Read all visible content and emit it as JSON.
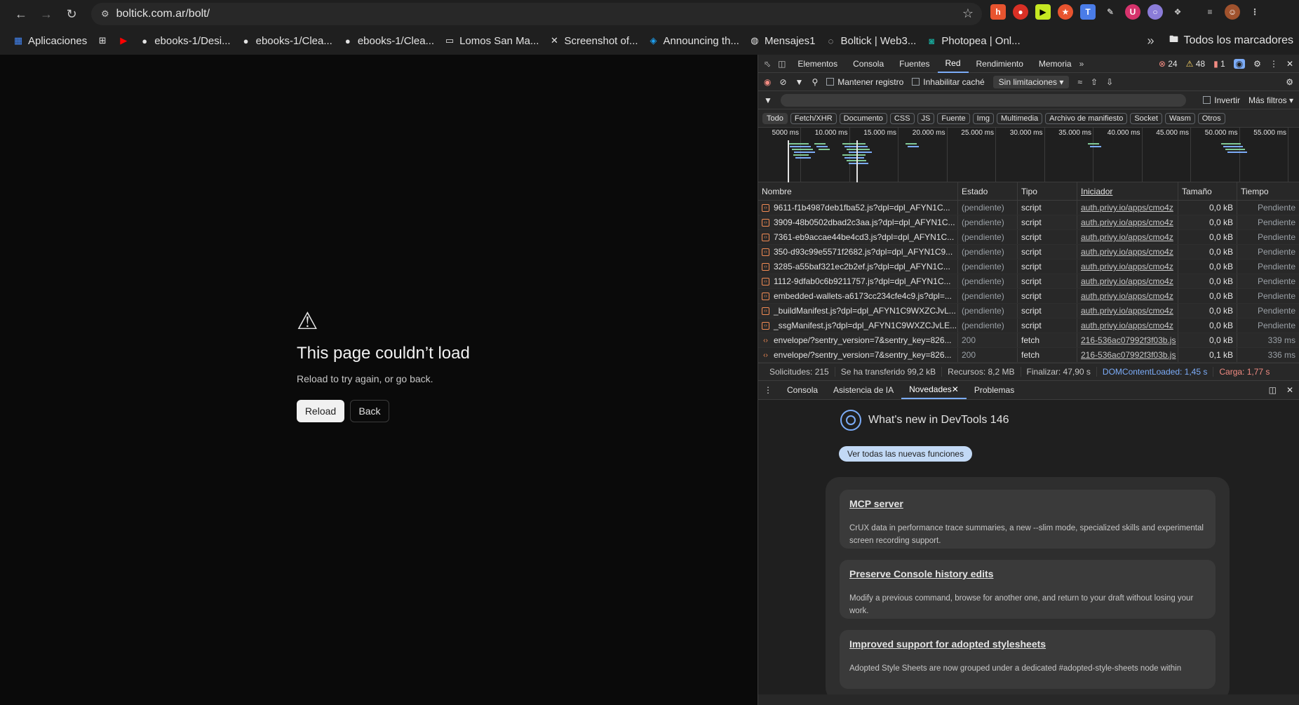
{
  "browser": {
    "url": "boltick.com.ar/bolt/",
    "bookmarks": [
      {
        "label": "Aplicaciones",
        "icon": "apps-grid-icon"
      },
      {
        "label": "",
        "icon": "grid-icon"
      },
      {
        "label": "",
        "icon": "youtube-icon"
      },
      {
        "label": "ebooks-1/Desi...",
        "icon": "github-icon"
      },
      {
        "label": "ebooks-1/Clea...",
        "icon": "github-icon"
      },
      {
        "label": "ebooks-1/Clea...",
        "icon": "github-icon"
      },
      {
        "label": "Lomos San Ma...",
        "icon": "folder-icon"
      },
      {
        "label": "Screenshot of...",
        "icon": "x-icon"
      },
      {
        "label": "Announcing th...",
        "icon": "announcement-icon"
      },
      {
        "label": "Mensajes1",
        "icon": "globe-icon"
      },
      {
        "label": "Boltick | Web3...",
        "icon": "loading-icon"
      },
      {
        "label": "Photopea | Onl...",
        "icon": "photopea-icon"
      }
    ],
    "bookmarks_more": "»",
    "all_bookmarks": "Todos los marcadores"
  },
  "error_page": {
    "title": "This page couldn’t load",
    "subtitle": "Reload to try again, or go back.",
    "reload": "Reload",
    "back": "Back"
  },
  "devtools": {
    "tabs": [
      "Elementos",
      "Consola",
      "Fuentes",
      "Red",
      "Rendimiento",
      "Memoria"
    ],
    "active_tab": "Red",
    "badges": {
      "errors": "24",
      "warnings": "48",
      "issues": "1"
    },
    "toolbar": {
      "preserve_log": "Mantener registro",
      "disable_cache": "Inhabilitar caché",
      "throttle": "Sin limitaciones"
    },
    "filter": {
      "invert": "Invertir",
      "more_filters": "Más filtros"
    },
    "chips": [
      "Todo",
      "Fetch/XHR",
      "Documento",
      "CSS",
      "JS",
      "Fuente",
      "Img",
      "Multimedia",
      "Archivo de manifiesto",
      "Socket",
      "Wasm",
      "Otros"
    ],
    "overview_ticks": [
      "5000 ms",
      "10.000 ms",
      "15.000 ms",
      "20.000 ms",
      "25.000 ms",
      "30.000 ms",
      "35.000 ms",
      "40.000 ms",
      "45.000 ms",
      "50.000 ms",
      "55.000 ms"
    ],
    "columns": [
      "Nombre",
      "Estado",
      "Tipo",
      "Iniciador",
      "Tamaño",
      "Tiempo"
    ],
    "rows": [
      {
        "name": "9611-f1b4987deb1fba52.js?dpl=dpl_AFYN1C...",
        "status": "(pendiente)",
        "type": "script",
        "initiator": "auth.privy.io/apps/cmo4z",
        "size": "0,0 kB",
        "time": "Pendiente"
      },
      {
        "name": "3909-48b0502dbad2c3aa.js?dpl=dpl_AFYN1C...",
        "status": "(pendiente)",
        "type": "script",
        "initiator": "auth.privy.io/apps/cmo4z",
        "size": "0,0 kB",
        "time": "Pendiente"
      },
      {
        "name": "7361-eb9accae44be4cd3.js?dpl=dpl_AFYN1C...",
        "status": "(pendiente)",
        "type": "script",
        "initiator": "auth.privy.io/apps/cmo4z",
        "size": "0,0 kB",
        "time": "Pendiente"
      },
      {
        "name": "350-d93c99e5571f2682.js?dpl=dpl_AFYN1C9...",
        "status": "(pendiente)",
        "type": "script",
        "initiator": "auth.privy.io/apps/cmo4z",
        "size": "0,0 kB",
        "time": "Pendiente"
      },
      {
        "name": "3285-a55baf321ec2b2ef.js?dpl=dpl_AFYN1C...",
        "status": "(pendiente)",
        "type": "script",
        "initiator": "auth.privy.io/apps/cmo4z",
        "size": "0,0 kB",
        "time": "Pendiente"
      },
      {
        "name": "1112-9dfab0c6b9211757.js?dpl=dpl_AFYN1C...",
        "status": "(pendiente)",
        "type": "script",
        "initiator": "auth.privy.io/apps/cmo4z",
        "size": "0,0 kB",
        "time": "Pendiente"
      },
      {
        "name": "embedded-wallets-a6173cc234cfe4c9.js?dpl=...",
        "status": "(pendiente)",
        "type": "script",
        "initiator": "auth.privy.io/apps/cmo4z",
        "size": "0,0 kB",
        "time": "Pendiente"
      },
      {
        "name": "_buildManifest.js?dpl=dpl_AFYN1C9WXZCJvL...",
        "status": "(pendiente)",
        "type": "script",
        "initiator": "auth.privy.io/apps/cmo4z",
        "size": "0,0 kB",
        "time": "Pendiente"
      },
      {
        "name": "_ssgManifest.js?dpl=dpl_AFYN1C9WXZCJvLE...",
        "status": "(pendiente)",
        "type": "script",
        "initiator": "auth.privy.io/apps/cmo4z",
        "size": "0,0 kB",
        "time": "Pendiente"
      },
      {
        "name": "envelope/?sentry_version=7&sentry_key=826...",
        "status": "200",
        "type": "fetch",
        "initiator": "216-536ac07992f3f03b.js",
        "size": "0,0 kB",
        "time": "339 ms"
      },
      {
        "name": "envelope/?sentry_version=7&sentry_key=826...",
        "status": "200",
        "type": "fetch",
        "initiator": "216-536ac07992f3f03b.js",
        "size": "0,1 kB",
        "time": "336 ms"
      }
    ],
    "summary": [
      "Solicitudes: 215",
      "Se ha transferido 99,2 kB",
      "Recursos: 8,2 MB",
      "Finalizar: 47,90 s",
      "DOMContentLoaded: 1,45 s",
      "Carga: 1,77 s"
    ],
    "drawer_tabs": [
      "Consola",
      "Asistencia de IA",
      "Novedades",
      "Problemas"
    ],
    "drawer_active": "Novedades",
    "whats_new": {
      "title": "What's new in DevTools 146",
      "button": "Ver todas las nuevas funciones",
      "features": [
        {
          "title": "MCP server",
          "desc": "CrUX data in performance trace summaries, a new --slim mode, specialized skills and experimental screen recording support."
        },
        {
          "title": "Preserve Console history edits",
          "desc": "Modify a previous command, browse for another one, and return to your draft without losing your work."
        },
        {
          "title": "Improved support for adopted stylesheets",
          "desc": "Adopted Style Sheets are now grouped under a dedicated #adopted-style-sheets node within"
        }
      ]
    }
  }
}
